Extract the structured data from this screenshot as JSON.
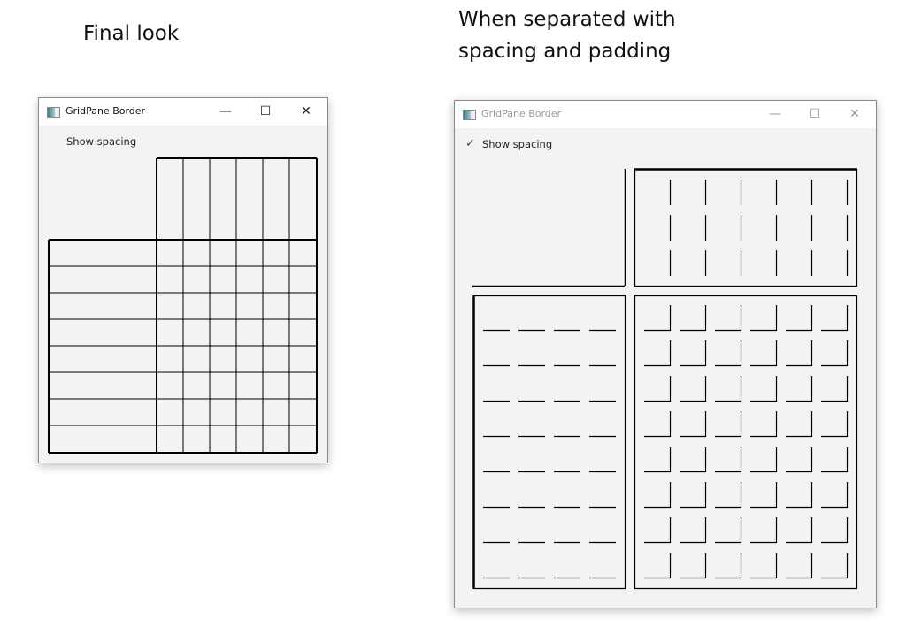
{
  "captions": {
    "left": "Final look",
    "right_line1": "When separated with",
    "right_line2": "spacing and padding"
  },
  "windows": [
    {
      "title": "GridPane Border",
      "checkbox_label": "Show spacing",
      "checked": false
    },
    {
      "title": "GridPane Border",
      "checkbox_label": "Show spacing",
      "checked": true
    }
  ],
  "controls": {
    "minimize": "—",
    "maximize": "☐",
    "close": "✕",
    "check": "✓"
  },
  "grid": {
    "left_columns": 4,
    "right_columns": 6,
    "header_rows": 3,
    "body_rows": 8
  }
}
